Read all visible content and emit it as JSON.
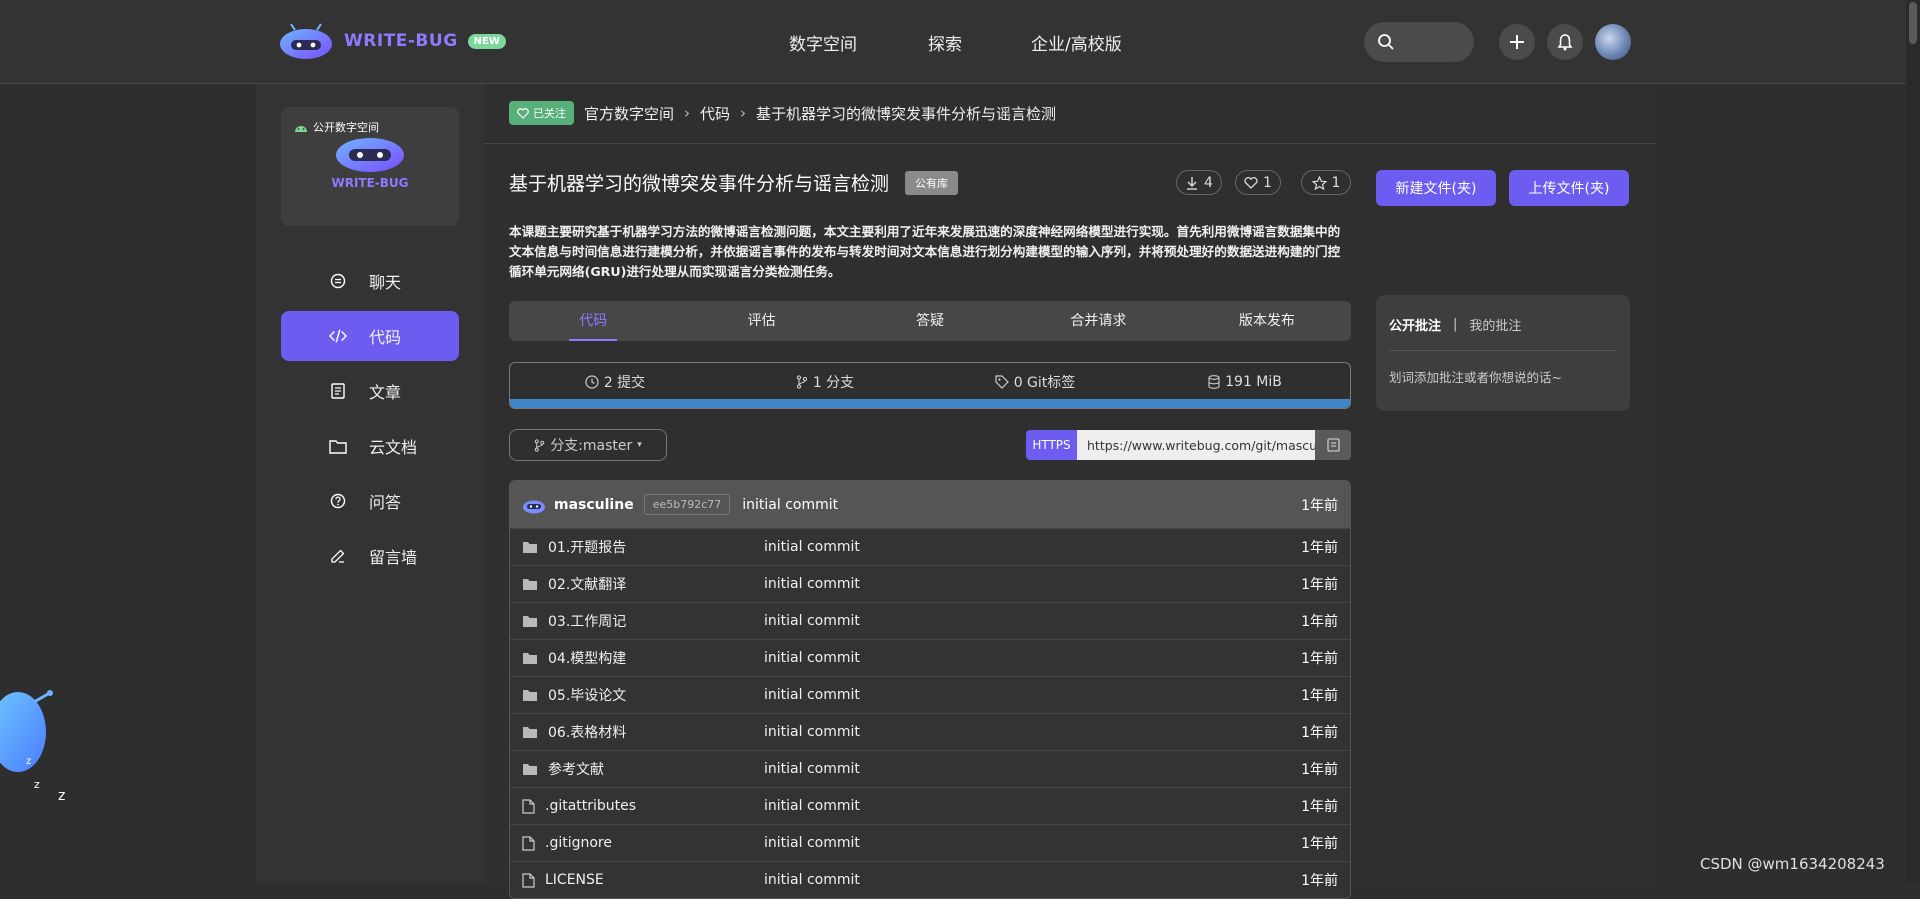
{
  "header": {
    "logo_text": "WRITE-BUG",
    "new_badge": "NEW",
    "nav": [
      "数字空间",
      "探索",
      "企业/高校版"
    ]
  },
  "sidebar": {
    "space_label": "公开数字空间",
    "space_logo_text": "WRITE-BUG",
    "items": [
      {
        "label": "聊天",
        "icon": "chat-icon"
      },
      {
        "label": "代码",
        "icon": "code-icon",
        "active": true
      },
      {
        "label": "文章",
        "icon": "article-icon"
      },
      {
        "label": "云文档",
        "icon": "folder-icon"
      },
      {
        "label": "问答",
        "icon": "question-icon"
      },
      {
        "label": "留言墙",
        "icon": "edit-icon"
      }
    ]
  },
  "breadcrumb": {
    "follow_badge": "已关注",
    "items": [
      "官方数字空间",
      "代码",
      "基于机器学习的微博突发事件分析与谣言检测"
    ]
  },
  "repo": {
    "title": "基于机器学习的微博突发事件分析与谣言检测",
    "badge": "公有库",
    "downloads": "4",
    "likes": "1",
    "stars": "1",
    "new_button": "新建文件(夹)",
    "upload_button": "上传文件(夹)",
    "description": "本课题主要研究基于机器学习方法的微博谣言检测问题，本文主要利用了近年来发展迅速的深度神经网络模型进行实现。首先利用微博谣言数据集中的文本信息与时间信息进行建模分析，并依据谣言事件的发布与转发时间对文本信息进行划分构建模型的输入序列，并将预处理好的数据送进构建的门控循环单元网络(GRU)进行处理从而实现谣言分类检测任务。"
  },
  "tabs": [
    "代码",
    "评估",
    "答疑",
    "合并请求",
    "版本发布"
  ],
  "stats": {
    "commits": "2 提交",
    "branches": "1 分支",
    "tags": "0 Git标签",
    "size": "191 MiB"
  },
  "branch": {
    "label": "分支:master"
  },
  "clone": {
    "protocol": "HTTPS",
    "url": "https://www.writebug.com/git/masculine"
  },
  "latest_commit": {
    "user": "masculine",
    "hash": "ee5b792c77",
    "message": "initial commit",
    "time": "1年前"
  },
  "files": [
    {
      "name": "01.开题报告",
      "type": "folder",
      "message": "initial commit",
      "time": "1年前"
    },
    {
      "name": "02.文献翻译",
      "type": "folder",
      "message": "initial commit",
      "time": "1年前"
    },
    {
      "name": "03.工作周记",
      "type": "folder",
      "message": "initial commit",
      "time": "1年前"
    },
    {
      "name": "04.模型构建",
      "type": "folder",
      "message": "initial commit",
      "time": "1年前"
    },
    {
      "name": "05.毕设论文",
      "type": "folder",
      "message": "initial commit",
      "time": "1年前"
    },
    {
      "name": "06.表格材料",
      "type": "folder",
      "message": "initial commit",
      "time": "1年前"
    },
    {
      "name": "参考文献",
      "type": "folder",
      "message": "initial commit",
      "time": "1年前"
    },
    {
      "name": ".gitattributes",
      "type": "file",
      "message": "initial commit",
      "time": "1年前"
    },
    {
      "name": ".gitignore",
      "type": "file",
      "message": "initial commit",
      "time": "1年前"
    },
    {
      "name": "LICENSE",
      "type": "file",
      "message": "initial commit",
      "time": "1年前"
    }
  ],
  "notes": {
    "tab_public": "公开批注",
    "separator": "|",
    "tab_mine": "我的批注",
    "hint": "划词添加批注或者你想说的话~"
  },
  "watermark": "CSDN @wm1634208243",
  "colors": {
    "accent": "#6c5df0",
    "brand_text": "#8b7bff",
    "follow_green": "#57b07a",
    "progress_blue": "#3f86c9"
  }
}
